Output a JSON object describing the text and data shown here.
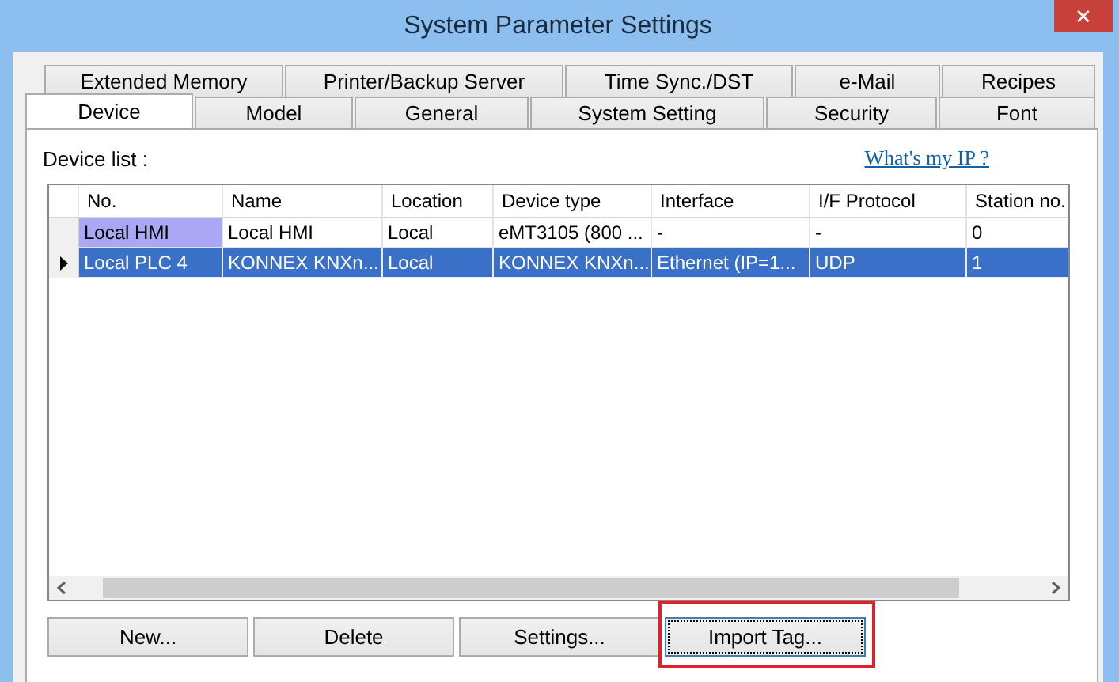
{
  "window": {
    "title": "System Parameter Settings",
    "close": "✕"
  },
  "tab_rows": [
    [
      {
        "label": "Extended Memory",
        "selected": false
      },
      {
        "label": "Printer/Backup Server",
        "selected": false
      },
      {
        "label": "Time Sync./DST",
        "selected": false
      },
      {
        "label": "e-Mail",
        "selected": false
      },
      {
        "label": "Recipes",
        "selected": false
      }
    ],
    [
      {
        "label": "Device",
        "selected": true
      },
      {
        "label": "Model",
        "selected": false
      },
      {
        "label": "General",
        "selected": false
      },
      {
        "label": "System Setting",
        "selected": false
      },
      {
        "label": "Security",
        "selected": false
      },
      {
        "label": "Font",
        "selected": false
      }
    ]
  ],
  "device_list_label": "Device list :",
  "link": "What's my IP ?",
  "table": {
    "columns": [
      "No.",
      "Name",
      "Location",
      "Device type",
      "Interface",
      "I/F Protocol",
      "Station no."
    ],
    "rows": [
      {
        "selected": false,
        "current": false,
        "first_cell_highlighted": true,
        "cells": [
          "Local HMI",
          "Local HMI",
          "Local",
          "eMT3105 (800 ...",
          "-",
          "-",
          "0"
        ]
      },
      {
        "selected": true,
        "current": true,
        "first_cell_highlighted": false,
        "cells": [
          "Local PLC 4",
          "KONNEX KNXn...",
          "Local",
          "KONNEX KNXn...",
          "Ethernet (IP=1...",
          "UDP",
          "1"
        ]
      }
    ]
  },
  "buttons": [
    {
      "label": "New...",
      "highlighted": false
    },
    {
      "label": "Delete",
      "highlighted": false
    },
    {
      "label": "Settings...",
      "highlighted": false
    },
    {
      "label": "Import Tag...",
      "highlighted": true
    }
  ]
}
